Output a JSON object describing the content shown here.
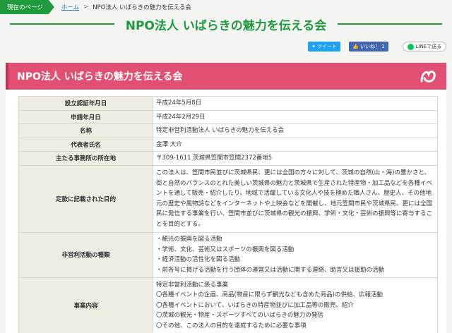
{
  "breadcrumb": {
    "current_label": "現在のページ",
    "home": "ホーム",
    "separator": ">",
    "page": "NPO法人 いばらきの魅力を伝える会"
  },
  "page_title": "NPO法人 いばらきの魅力を伝える会",
  "social": {
    "tweet": "ツイート",
    "like": "いいね！ 1",
    "line": "LINEで送る"
  },
  "panel": {
    "title": "NPO法人 いばらきの魅力を伝える会",
    "rows": [
      {
        "label": "設立認証年月日",
        "value": "平成24年5月8日"
      },
      {
        "label": "申請年月日",
        "value": "平成24年2月29日"
      },
      {
        "label": "名称",
        "value": "特定非営利活動法人 いばらきの魅力を伝える会"
      },
      {
        "label": "代表者氏名",
        "value": "金澤 大介"
      },
      {
        "label": "主たる事務所の所在地",
        "value": "〒309-1611 茨城県笠間市笠間2372番地5"
      }
    ],
    "purpose": {
      "label": "定款に記載された目的",
      "value": "この法人は、笠間市民並びに茨城県民、更には全国の方々に対して、茨城の自然(山・海)の豊かさと、街と自然のバランスのとれた美しい茨城県の魅力と茨城県で生産された特産物・加工品などを各種イベントを通して販売・紹介したり、地域で活躍している文化人や技を極めた職人さん、歴史人、その他地元の歴史や風物詩などをインターネットや上映会などを開催し、地元笠間市民や茨城県民、更には全国民に発信する事業を行い、笠間市並びに茨城県の観光の振興、学術・文化・芸術の振興等に寄与することを目的とする。"
    },
    "activities": {
      "label": "非営利活動の種類",
      "items": [
        "・観光の振興を図る活動",
        "・学術、文化、芸術又はスポーツの振興を図る活動",
        "・経済活動の活性化を図る活動",
        "・前各号に掲げる活動を行う団体の運営又は活動に関する連絡、助言又は援助の活動"
      ]
    },
    "business": {
      "label": "事業内容",
      "items": [
        "特定非営利活動に係る事業",
        "〇各種イベントの企画、商品(物産に限らず観光なども含めた商品)の供給、広報活動",
        "〇各種イベントにおいて、いばらきの特産物並びに加工品等の販売、紹介",
        "〇茨城の観光・物産・スポーツすべてのいばらきの魅力の発信",
        "〇その他、この法人の目的を達成するために必要な事項"
      ]
    }
  }
}
